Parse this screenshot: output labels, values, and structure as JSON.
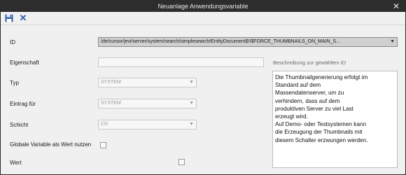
{
  "window": {
    "title": "Neuanlage Anwendungsvariable",
    "close_glyph": "✕"
  },
  "toolbar": {
    "save_icon": "floppy-disk-icon",
    "discard_icon": "x-icon",
    "discard_glyph": "✕"
  },
  "form": {
    "id": {
      "label": "ID",
      "value": "/de/cursor/jevi/server/system/search/simplesearch/EntityDocument$!!$FORCE_THUMBNAILS_ON_MAIN_S..."
    },
    "eigenschaft": {
      "label": "Eigenschaft",
      "value": ""
    },
    "typ": {
      "label": "Typ",
      "value": "SYSTEM"
    },
    "eintrag_fuer": {
      "label": "Eintrag für",
      "value": "SYSTEM"
    },
    "schicht": {
      "label": "Schicht",
      "value": "CN"
    },
    "globale_variable": {
      "label": "Globale Variable als Wert nutzen",
      "checked": false
    },
    "wert": {
      "label": "Wert",
      "checked": false
    }
  },
  "description": {
    "label": "Beschreibung zur gewählten ID",
    "text": "Die Thumbnailgenerierung erfolgt im\nStandard auf dem\nMassendatenserver, um zu\nverhindern, dass auf dem\nproduktiven Server zu viel Last\nerzeugt wird.\nAuf Demo- oder Testsystemen kann\ndie Erzeugung der Thumbnails mit\ndiesem Schalter erzwungen werden."
  },
  "colors": {
    "titlebar": "#2d2d2d",
    "accent_blue": "#2a5ea8"
  }
}
